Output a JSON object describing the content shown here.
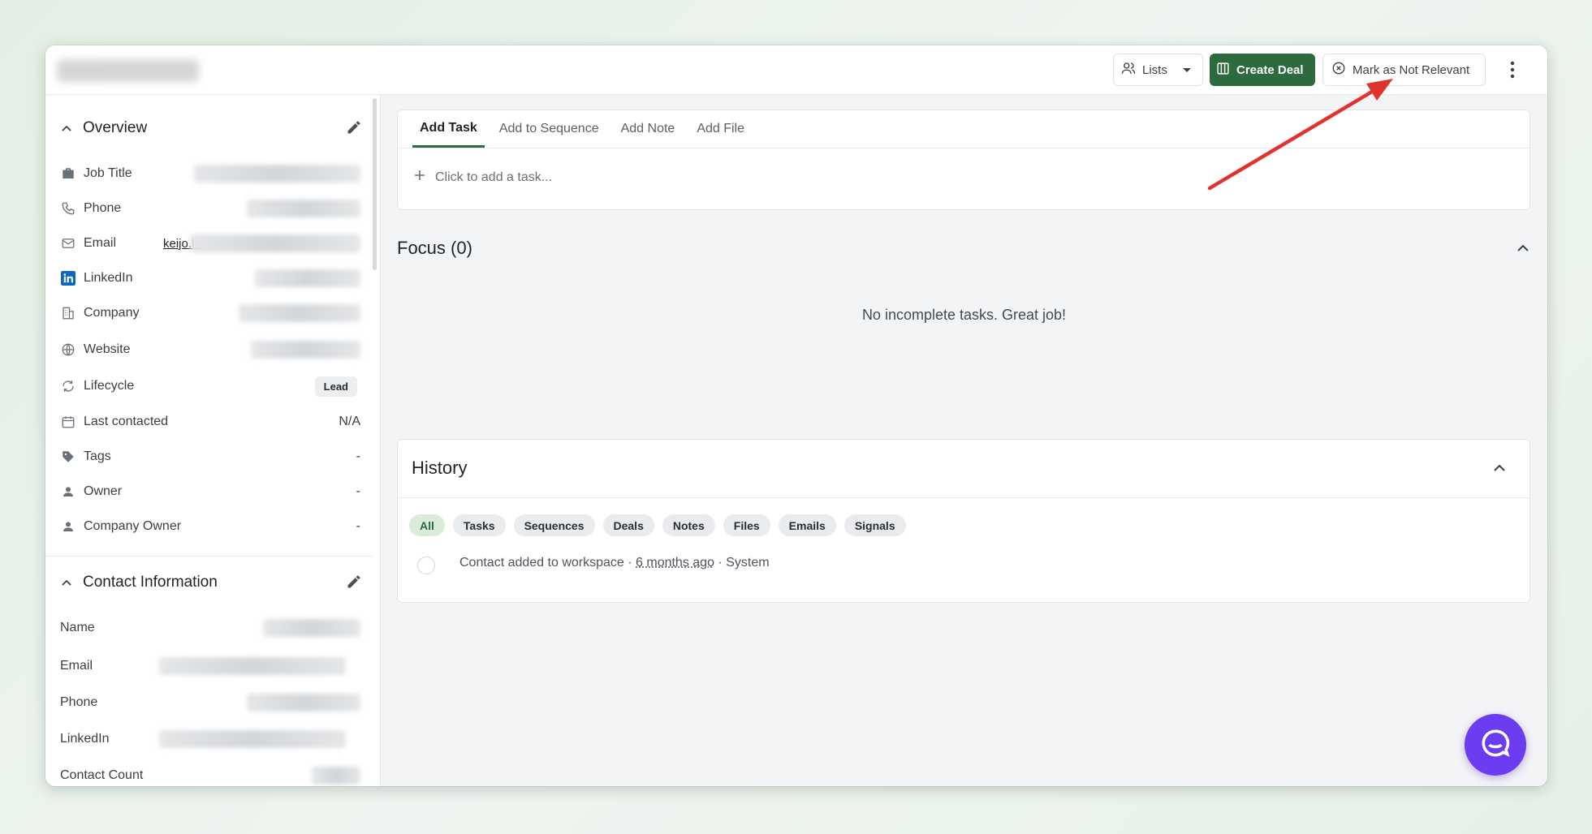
{
  "header": {
    "lists_label": "Lists",
    "create_deal_label": "Create Deal",
    "not_relevant_label": "Mark as Not Relevant"
  },
  "overview": {
    "title": "Overview",
    "rows": {
      "job_title": "Job Title",
      "phone": "Phone",
      "email": "Email",
      "email_value": "keijo.la",
      "linkedin": "LinkedIn",
      "company": "Company",
      "website": "Website",
      "lifecycle": "Lifecycle",
      "lifecycle_value": "Lead",
      "last_contacted": "Last contacted",
      "last_contacted_value": "N/A",
      "tags": "Tags",
      "tags_value": "-",
      "owner": "Owner",
      "owner_value": "-",
      "company_owner": "Company Owner",
      "company_owner_value": "-"
    }
  },
  "contact_info": {
    "title": "Contact Information",
    "rows": {
      "name": "Name",
      "email": "Email",
      "phone": "Phone",
      "linkedin": "LinkedIn",
      "contact_count": "Contact Count"
    }
  },
  "tabs": [
    "Add Task",
    "Add to Sequence",
    "Add Note",
    "Add File"
  ],
  "add_task_placeholder": "Click to add a task...",
  "focus": {
    "title": "Focus (0)",
    "empty": "No incomplete tasks. Great job!"
  },
  "history": {
    "title": "History",
    "chips": [
      "All",
      "Tasks",
      "Sequences",
      "Deals",
      "Notes",
      "Files",
      "Emails",
      "Signals"
    ],
    "event": {
      "text": "Contact added to workspace ·",
      "time": "6 months ago",
      "source": "· System"
    }
  },
  "colors": {
    "primary": "#2d6a3e",
    "chat": "#6c3cf0",
    "annotation": "#e0332f"
  }
}
